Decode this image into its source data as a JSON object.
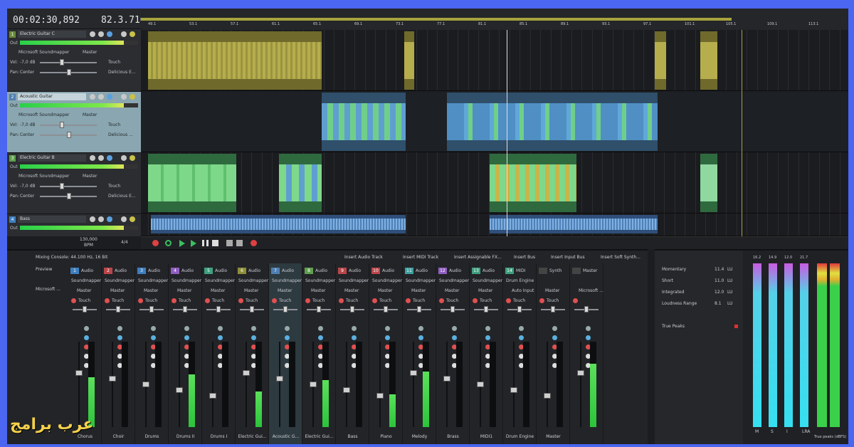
{
  "header": {
    "time": "00:02:30,892",
    "beat": "82.3.716"
  },
  "tracks": [
    {
      "num": "1",
      "name": "Electric Guitar C",
      "out": "Microsoft Soundmapper",
      "bus": "Master",
      "vol": "-7,0 dB",
      "pan": "Center",
      "touch": "Touch",
      "fx": "Delicious E..."
    },
    {
      "num": "2",
      "name": "Acoustic Guitar",
      "out": "Microsoft Soundmapper",
      "bus": "Master",
      "vol": "-7,0 dB",
      "pan": "Center",
      "touch": "Touch",
      "fx": "Delicious ..."
    },
    {
      "num": "3",
      "name": "Electric Guitar B",
      "out": "Microsoft Soundmapper",
      "bus": "Master",
      "vol": "-7,0 dB",
      "pan": "Center",
      "touch": "Touch",
      "fx": "Delicious E..."
    },
    {
      "num": "4",
      "name": "Bass",
      "out": "Out",
      "bus": "",
      "vol": "",
      "pan": "",
      "touch": "",
      "fx": ""
    }
  ],
  "labels": {
    "out": "Out",
    "vol": "Vol:",
    "pan": "Pan:"
  },
  "tempo": {
    "bpm": "130,000",
    "bpm_label": "BPM",
    "sig": "4/4"
  },
  "ruler_ticks": [
    "49.1",
    "53.1",
    "57.1",
    "61.1",
    "65.1",
    "69.1",
    "73.1",
    "77.1",
    "81.1",
    "85.1",
    "89.1",
    "93.1",
    "97.1",
    "101.1",
    "105.1",
    "109.1",
    "113.1"
  ],
  "mixer": {
    "title": "Mixing Console: 44.100 Hz, 16 Bit",
    "toolbar": [
      "Insert Audio Track",
      "Insert MIDI Track",
      "Insert Assignable FX...",
      "Insert Bus",
      "Insert Input Bus",
      "Insert Soft Synth..."
    ],
    "preview": "Preview",
    "device": "Microsoft ...",
    "strips": [
      {
        "n": "1",
        "type": "Audio",
        "out": "Soundmapper",
        "bus": "Master",
        "auto": "Touch",
        "name": "Chorus",
        "color": "#3f7fbf",
        "level": 0.58
      },
      {
        "n": "2",
        "type": "Audio",
        "out": "Soundmapper",
        "bus": "Master",
        "auto": "Touch",
        "name": "Choir",
        "color": "#b8464a",
        "level": 0.0
      },
      {
        "n": "3",
        "type": "Audio",
        "out": "Soundmapper",
        "bus": "Master",
        "auto": "Touch",
        "name": "Drums",
        "color": "#3f7fbf",
        "level": 0.0
      },
      {
        "n": "4",
        "type": "Audio",
        "out": "Soundmapper",
        "bus": "Master",
        "auto": "Touch",
        "name": "Drums II",
        "color": "#8f5fbf",
        "level": 0.62
      },
      {
        "n": "5",
        "type": "Audio",
        "out": "Soundmapper",
        "bus": "Master",
        "auto": "Touch",
        "name": "Drums I",
        "color": "#3fa07f",
        "level": 0.0
      },
      {
        "n": "6",
        "type": "Audio",
        "out": "Soundmapper",
        "bus": "Master",
        "auto": "Touch",
        "name": "Electric Gui...",
        "color": "#8f8f3a",
        "level": 0.42
      },
      {
        "n": "7",
        "type": "Audio",
        "out": "Soundmapper",
        "bus": "Master",
        "auto": "Touch",
        "name": "Acoustic G...",
        "color": "#4f7fb0",
        "level": 0.0
      },
      {
        "n": "8",
        "type": "Audio",
        "out": "Soundmapper",
        "bus": "Master",
        "auto": "Touch",
        "name": "Electric Gui...",
        "color": "#5f9f4f",
        "level": 0.55
      },
      {
        "n": "9",
        "type": "Audio",
        "out": "Soundmapper",
        "bus": "Master",
        "auto": "Touch",
        "name": "Bass",
        "color": "#b8464a",
        "level": 0.0
      },
      {
        "n": "10",
        "type": "Audio",
        "out": "Soundmapper",
        "bus": "Master",
        "auto": "Touch",
        "name": "Piano",
        "color": "#b8464a",
        "level": 0.38
      },
      {
        "n": "11",
        "type": "Audio",
        "out": "Soundmapper",
        "bus": "Master",
        "auto": "Touch",
        "name": "Melody",
        "color": "#3f9f9f",
        "level": 0.65
      },
      {
        "n": "12",
        "type": "Audio",
        "out": "Soundmapper",
        "bus": "Master",
        "auto": "Touch",
        "name": "Brass",
        "color": "#8f5fbf",
        "level": 0.0
      },
      {
        "n": "13",
        "type": "Audio",
        "out": "Soundmapper",
        "bus": "Master",
        "auto": "Touch",
        "name": "MIDI1",
        "color": "#3f9f7f",
        "level": 0.0
      },
      {
        "n": "14",
        "type": "MIDI",
        "out": "Drum Engine",
        "bus": "Auto Input",
        "auto": "Touch",
        "name": "Drum Engine",
        "color": "#3f9f7f",
        "level": 0.0
      },
      {
        "n": "",
        "type": "Synth",
        "out": "",
        "bus": "Master",
        "auto": "Touch",
        "name": "Master",
        "color": "#444",
        "level": 0.0
      },
      {
        "n": "",
        "type": "Master",
        "out": "",
        "bus": "Microsoft ...",
        "auto": "",
        "name": "",
        "color": "#444",
        "level": 0.74
      }
    ]
  },
  "loudness": {
    "rows": [
      {
        "label": "Momentary",
        "value": "11.4",
        "unit": "LU"
      },
      {
        "label": "Short",
        "value": "11.0",
        "unit": "LU"
      },
      {
        "label": "Integrated",
        "value": "12.0",
        "unit": "LU"
      },
      {
        "label": "Loudness Range",
        "value": "8.1",
        "unit": "LU"
      }
    ],
    "true_peaks": "True Peaks",
    "meter_labels": [
      "M",
      "S",
      "I",
      "LRA"
    ],
    "meter_tops": [
      "16.2",
      "14.9",
      "12.0",
      "21.7"
    ],
    "true_peaks_label": "True peaks (dBFS)"
  },
  "watermark": "عرب برامج"
}
